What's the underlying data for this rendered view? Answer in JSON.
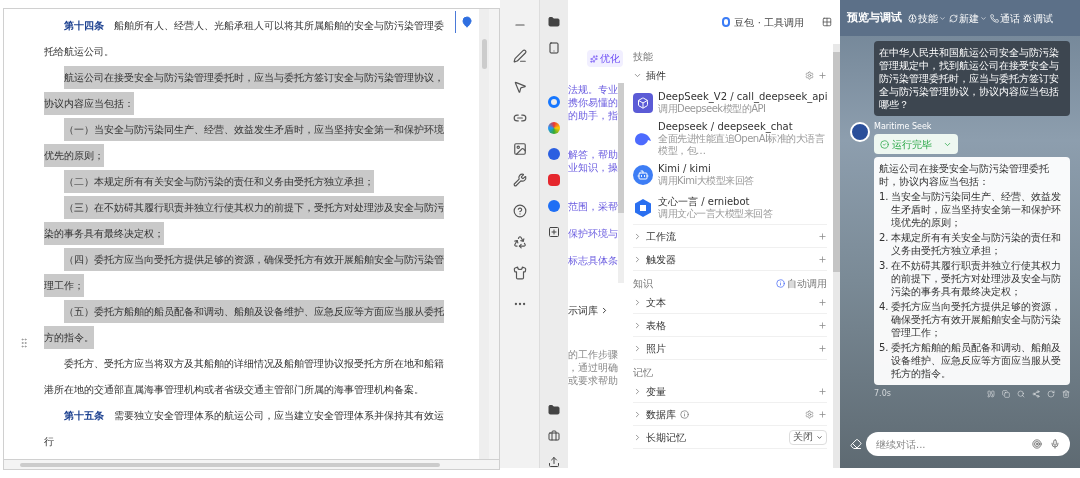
{
  "document": {
    "paragraphs": [
      {
        "label": "第十四条",
        "text": "船舶所有人、经营人、光船承租人可以将其所属船舶的安全与防污染管理委托给航运公司。",
        "highlighted": false
      },
      {
        "text": "航运公司在接受安全与防污染管理委托时，应当与委托方签订安全与防污染管理协议，协议内容应当包括：",
        "highlighted": true
      },
      {
        "text": "（一）当安全与防污染同生产、经营、效益发生矛盾时，应当坚持安全第一和保护环境优先的原则；",
        "highlighted": true
      },
      {
        "text": "（二）本规定所有有关安全与防污染的责任和义务由受托方独立承担；",
        "highlighted": true
      },
      {
        "text": "（三）在不妨碍其履行职责并独立行使其权力的前提下，受托方对处理涉及安全与防污染的事务具有最终决定权；",
        "highlighted": true
      },
      {
        "text": "（四）委托方应当向受托方提供足够的资源，确保受托方有效开展船舶安全与防污染管理工作；",
        "highlighted": true
      },
      {
        "text": "（五）委托方船舶的船员配备和调动、船舶及设备维护、应急反应等方面应当服从委托方的指令。",
        "highlighted": true
      },
      {
        "text": "委托方、受托方应当将双方及其船舶的详细情况及船舶管理协议报受托方所在地和船籍港所在地的交通部直属海事管理机构或者省级交通主管部门所属的海事管理机构备案。",
        "highlighted": false
      },
      {
        "label": "第十五条",
        "text": "需要独立安全管理体系的航运公司，应当建立安全管理体系并保持其有效运行",
        "highlighted": false
      }
    ]
  },
  "prompt_panel": {
    "optimize_button": "优化",
    "fragments": [
      "法规。专业",
      "携你易懂的",
      "的助手，指",
      "解答，帮助",
      "业知识，操",
      "范围，采帮",
      "保护环境与",
      "标志具体条"
    ],
    "prompt_library_link": "示词库",
    "notes": [
      "的工作步骤",
      "，通过明确",
      "或要求帮助"
    ]
  },
  "tool_panel": {
    "title": "豆包 · 工具调用",
    "sections": [
      {
        "heading": "技能",
        "groups": [
          {
            "label": "插件",
            "expanded": true,
            "info": false,
            "items": [
              {
                "kind": "cube",
                "name": "DeepSeek_V2 / call_deepseek_api",
                "description": "调用Deepseek模型的API"
              },
              {
                "kind": "whale",
                "name": "Deepseek / deepseek_chat",
                "description": "全面先进性能直追OpenAI标准的大语言模型，包…"
              },
              {
                "kind": "robot",
                "name": "Kimi / kimi",
                "description": "调用Kimi大模型来回答"
              },
              {
                "kind": "ernie",
                "name": "文心一言 / erniebot",
                "description": "调用文心一言大模型来回答"
              }
            ]
          },
          {
            "label": "工作流",
            "expanded": false,
            "info": false
          },
          {
            "label": "触发器",
            "expanded": false,
            "info": false
          }
        ]
      },
      {
        "heading": "知识",
        "action": "自动调用",
        "groups": [
          {
            "label": "文本",
            "expanded": false,
            "info": false
          },
          {
            "label": "表格",
            "expanded": false,
            "info": false
          },
          {
            "label": "照片",
            "expanded": false,
            "info": false
          }
        ]
      },
      {
        "heading": "记忆",
        "groups": [
          {
            "label": "变量",
            "expanded": false,
            "info": false
          },
          {
            "label": "数据库",
            "expanded": false,
            "info": true
          },
          {
            "label": "长期记忆",
            "expanded": false,
            "info": false,
            "setting": "关闭"
          }
        ]
      }
    ]
  },
  "chat": {
    "title": "预览与调试",
    "actions": [
      {
        "kind": "memory",
        "label": "技能",
        "dropdown": true
      },
      {
        "kind": "refresh",
        "label": "新建",
        "dropdown": true
      },
      {
        "kind": "phone",
        "label": "通话",
        "dropdown": false
      },
      {
        "kind": "debug",
        "label": "调试",
        "dropdown": false
      }
    ],
    "user_message": "在中华人民共和国航运公司安全与防污染管理规定中，找到航运公司在接受安全与防污染管理委托时，应当与委托方签订安全与防污染管理协议，协议内容应当包括哪些？",
    "bot_name": "Maritime Seek",
    "status": "运行完毕",
    "answer_intro": "航运公司在接受安全与防污染管理委托时，协议内容应当包括：",
    "answer_items": [
      {
        "number": "1.",
        "text": "当安全与防污染同生产、经营、效益发生矛盾时，应当坚持安全第一和保护环境优先的原则；"
      },
      {
        "number": "2.",
        "text": "本规定所有有关安全与防污染的责任和义务由受托方独立承担；"
      },
      {
        "number": "3.",
        "text": "在不妨碍其履行职责并独立行使其权力的前提下，受托方对处理涉及安全与防污染的事务具有最终决定权；"
      },
      {
        "number": "4.",
        "text": "委托方应当向受托方提供足够的资源，确保受托方有效开展船舶安全与防污染管理工作；"
      },
      {
        "number": "5.",
        "text": "委托方船舶的船员配备和调动、船舶及设备维护、应急反应等方面应当服从受托方的指令。"
      }
    ],
    "elapsed": "7.0s",
    "input_placeholder": "继续对话..."
  }
}
